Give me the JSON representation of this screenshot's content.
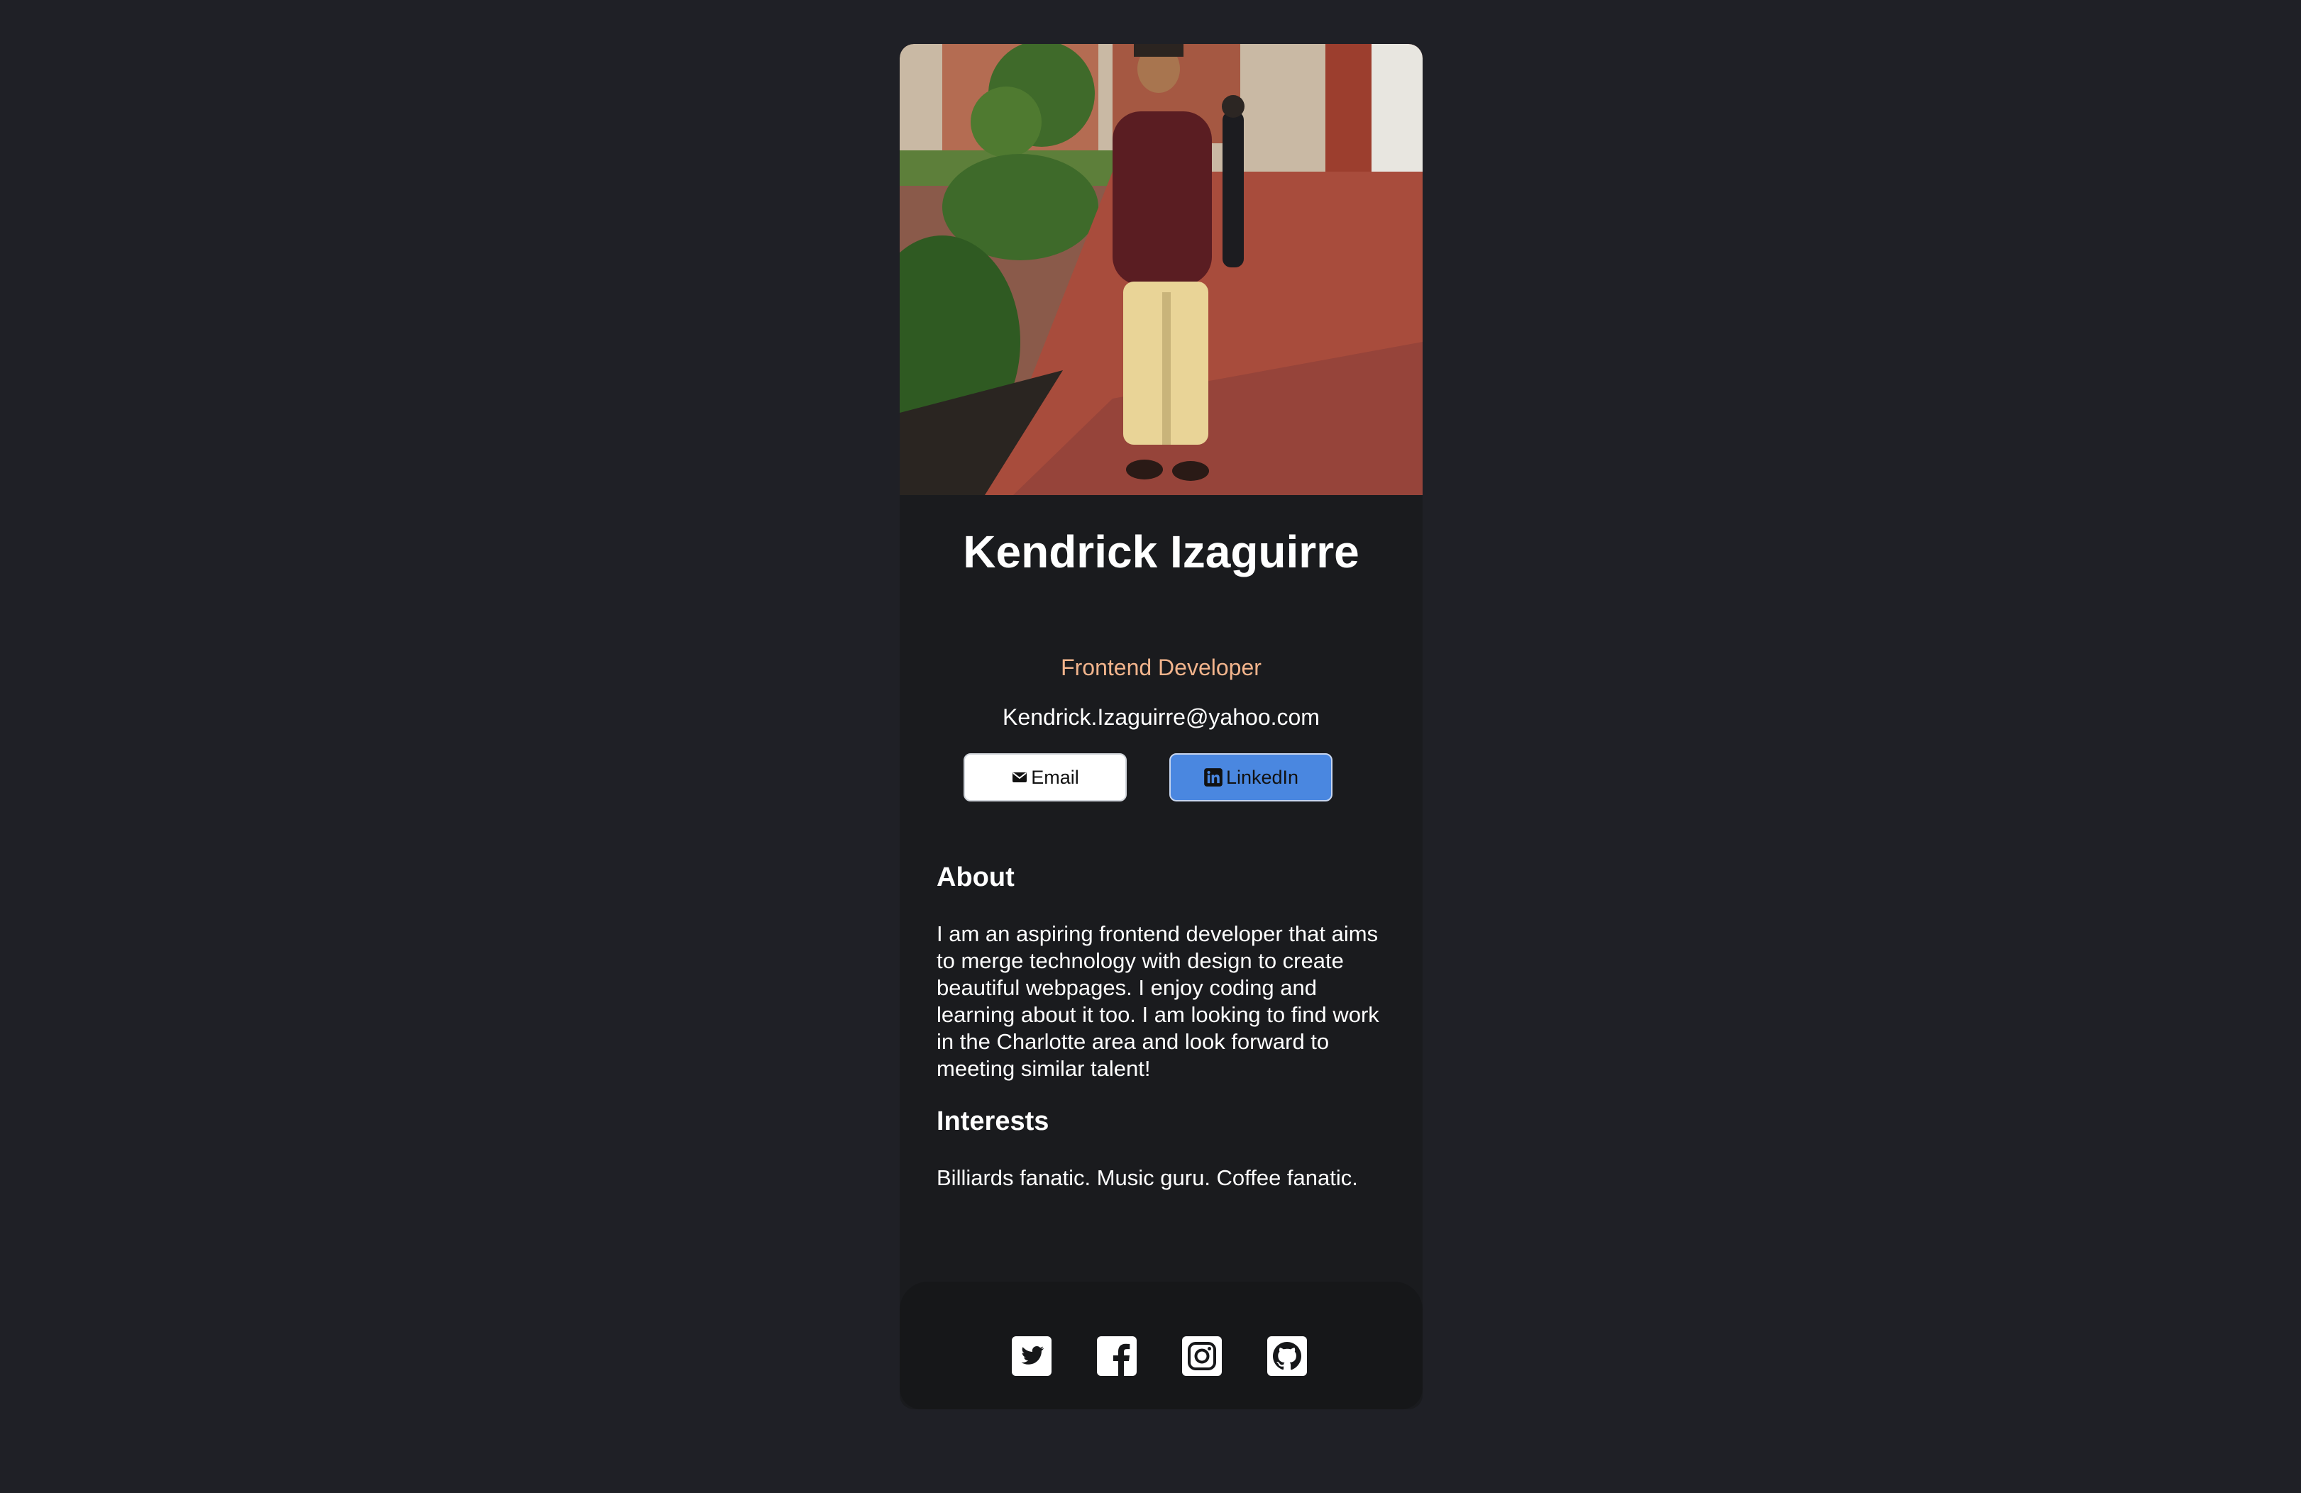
{
  "profile": {
    "name": "Kendrick Izaguirre",
    "title": "Frontend Developer",
    "email": "Kendrick.Izaguirre@yahoo.com"
  },
  "buttons": {
    "email_label": "Email",
    "linkedin_label": "LinkedIn"
  },
  "about": {
    "heading": "About",
    "text": "I am an aspiring frontend developer that aims to merge technology with design to create beautiful webpages. I enjoy coding and learning about it too. I am looking to find work in the Charlotte area and look forward to meeting similar talent!"
  },
  "interests": {
    "heading": "Interests",
    "text": "Billiards fanatic. Music guru. Coffee fanatic."
  },
  "footer": {
    "social_icons": [
      "twitter-icon",
      "facebook-icon",
      "instagram-icon",
      "github-icon"
    ]
  },
  "colors": {
    "page_background": "#1f2026",
    "card_background": "#1a1b1e",
    "footer_background": "#161719",
    "title_accent": "#f2b48c",
    "linkedin_button": "#4a87e0",
    "email_button": "#ffffff"
  }
}
